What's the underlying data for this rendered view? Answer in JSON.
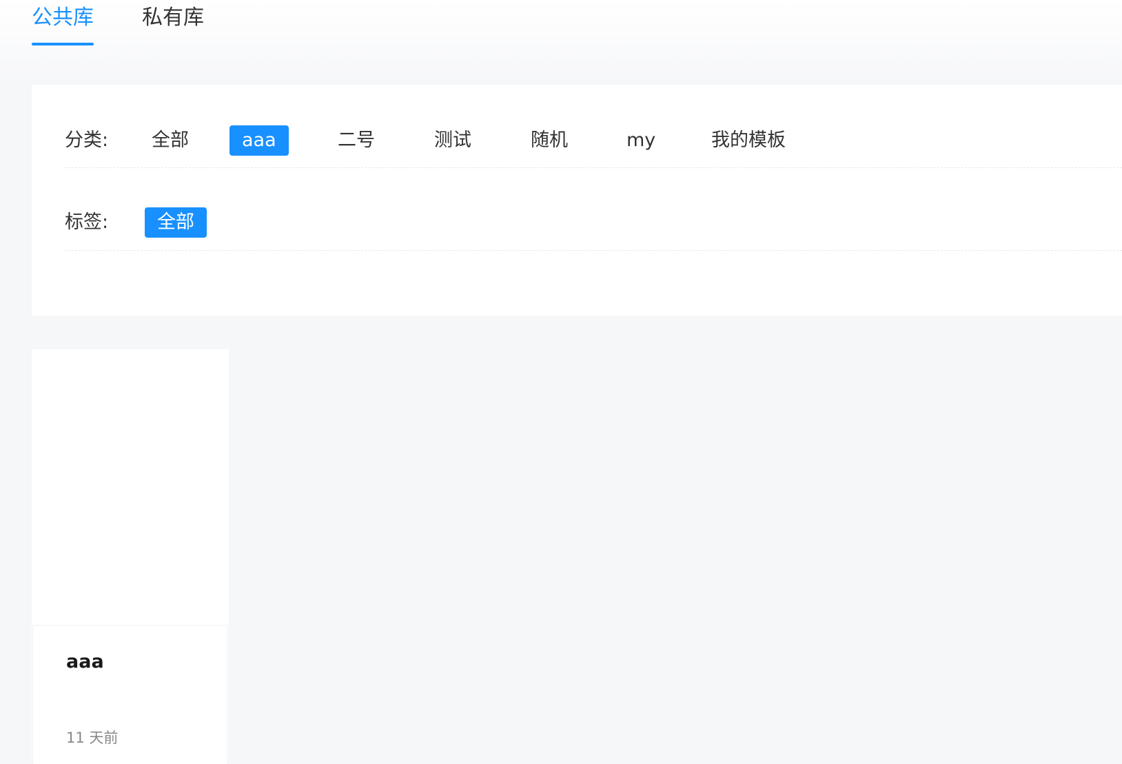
{
  "tabs": [
    {
      "label": "公共库",
      "active": true
    },
    {
      "label": "私有库",
      "active": false
    }
  ],
  "filters": {
    "category": {
      "label": "分类:",
      "options": [
        "全部",
        "aaa",
        "二号",
        "测试",
        "随机",
        "my",
        "我的模板"
      ],
      "selected": "aaa"
    },
    "tag": {
      "label": "标签:",
      "options": [
        "全部"
      ],
      "selected": "全部"
    }
  },
  "cards": [
    {
      "title": "aaa",
      "time": "11 天前"
    }
  ],
  "colors": {
    "accent": "#1890ff",
    "background": "#f6f7f9",
    "panel": "#ffffff"
  }
}
